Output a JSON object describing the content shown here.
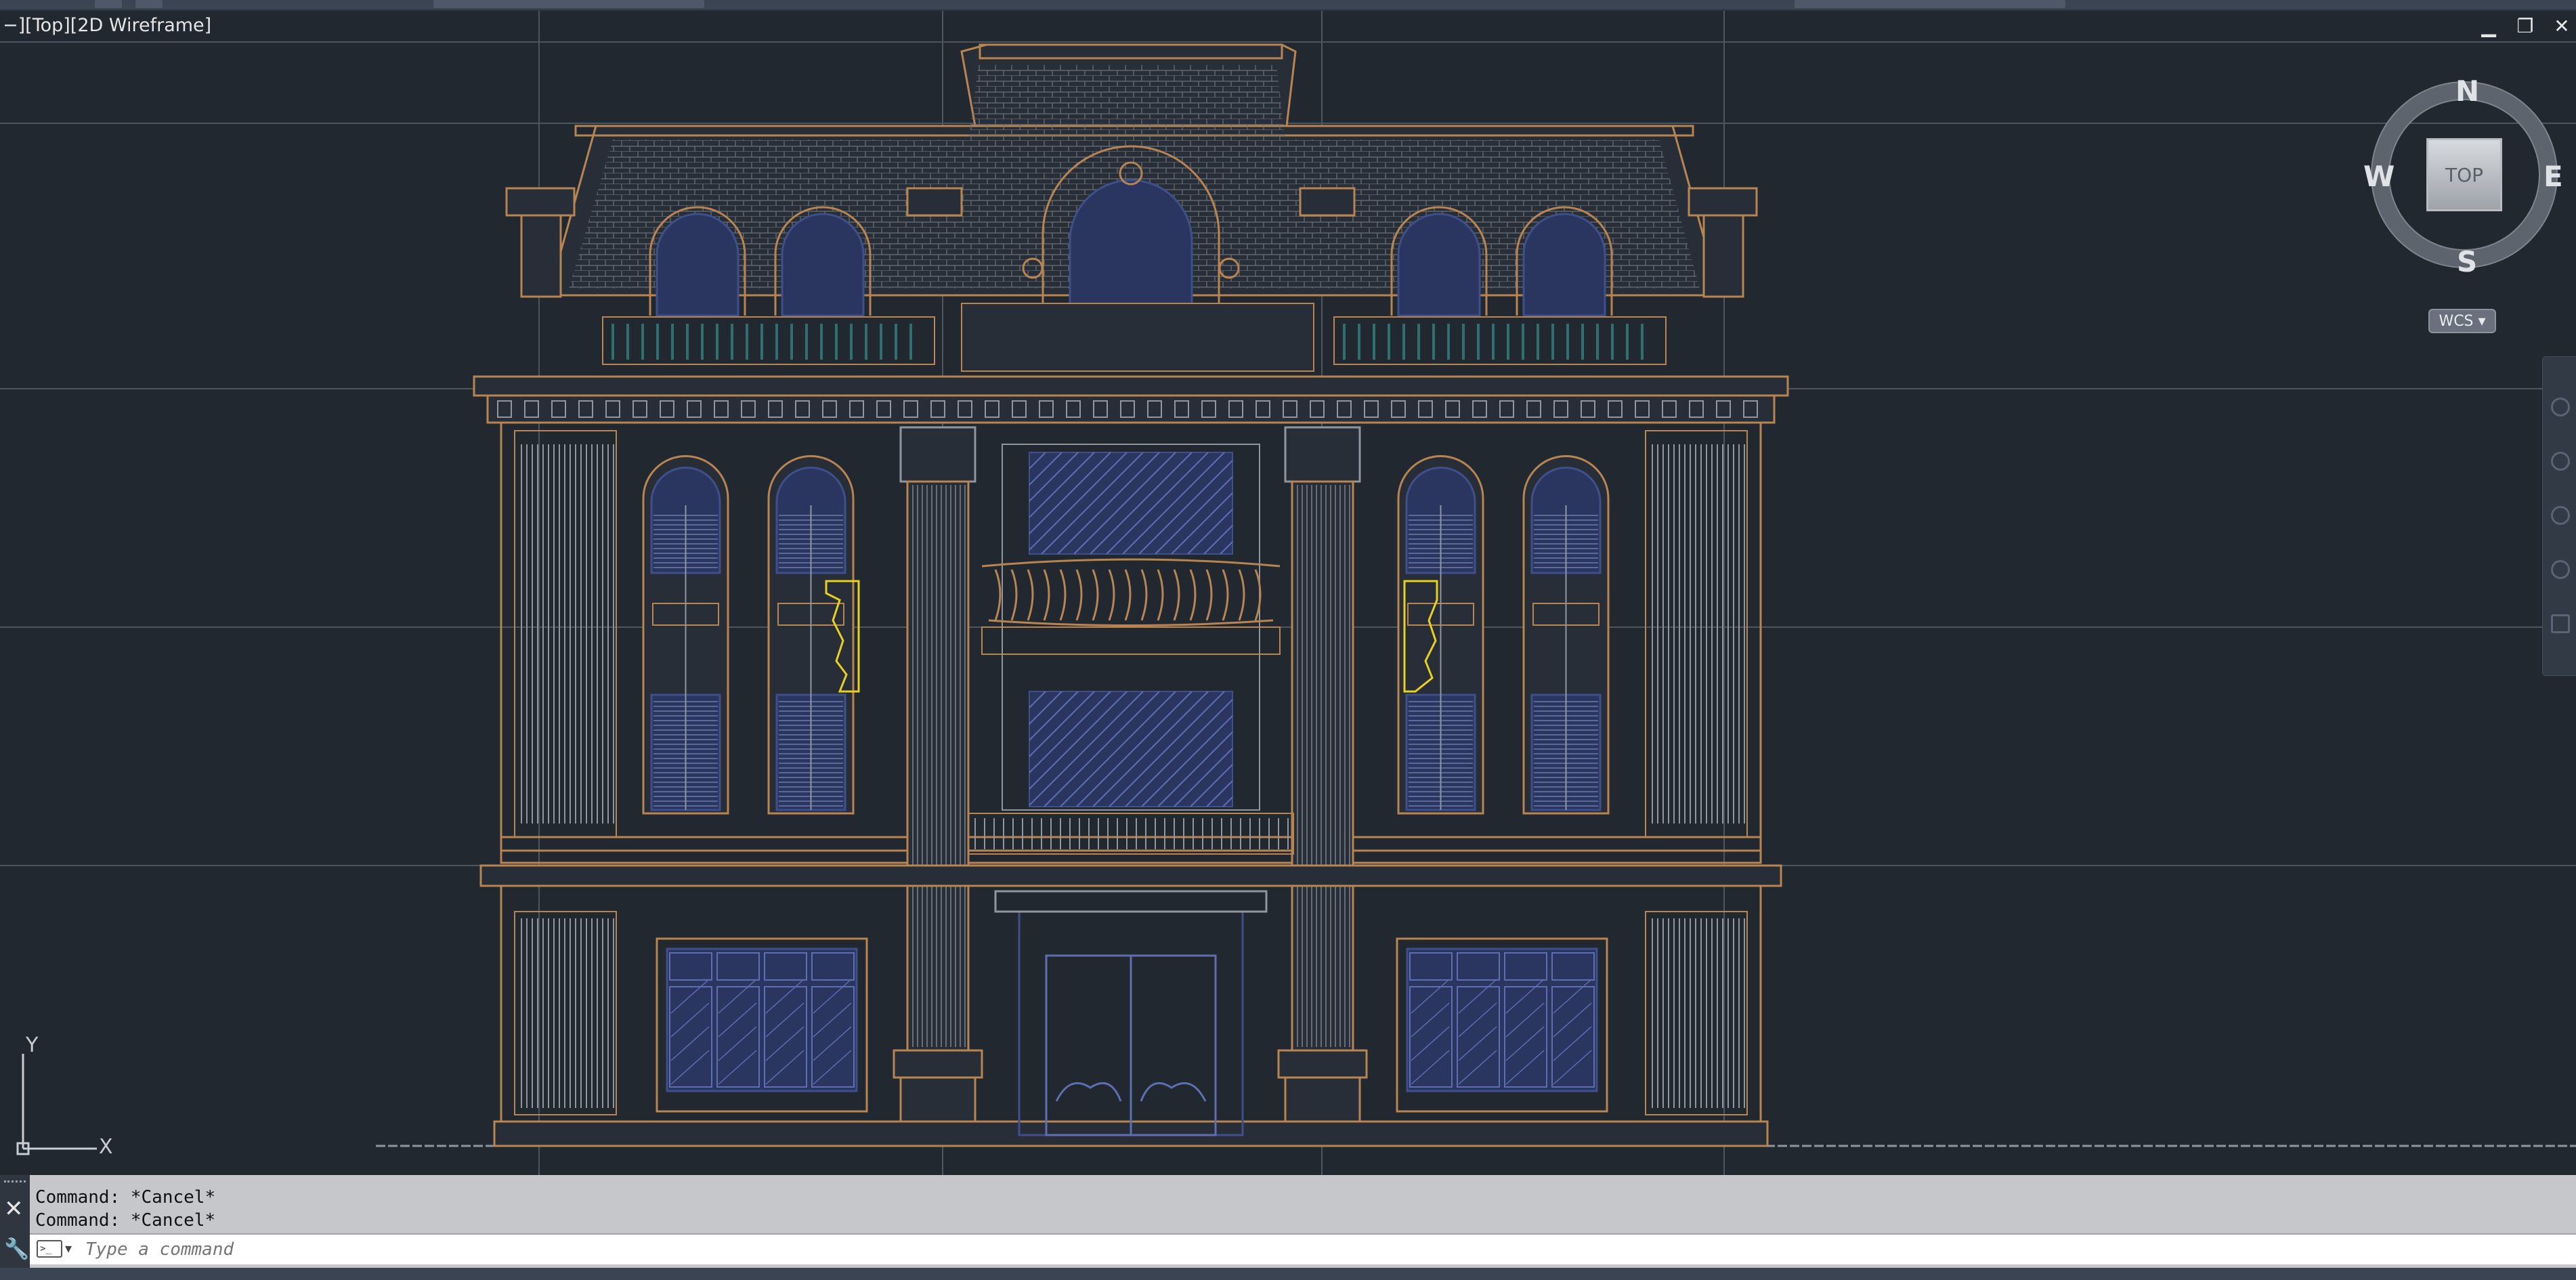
{
  "viewport": {
    "label": "−][Top][2D Wireframe]"
  },
  "window_controls": {
    "minimize": "▁",
    "restore": "❐",
    "close": "✕"
  },
  "viewcube": {
    "north": "N",
    "south": "S",
    "east": "E",
    "west": "W",
    "face": "TOP",
    "wcs": "WCS ▾"
  },
  "ucs": {
    "x": "X",
    "y": "Y"
  },
  "command_line": {
    "history": [
      "Command: *Cancel*",
      "Command: *Cancel*"
    ],
    "placeholder": "Type a command",
    "prompt_icon": ">_"
  },
  "colors": {
    "background": "#212830",
    "outline_orange": "#b88552",
    "outline_grey": "#8f969f",
    "glass_blue": "#3f4f8a",
    "highlight_yellow": "#e8d020",
    "balustrade_teal": "#2f6f6f"
  }
}
